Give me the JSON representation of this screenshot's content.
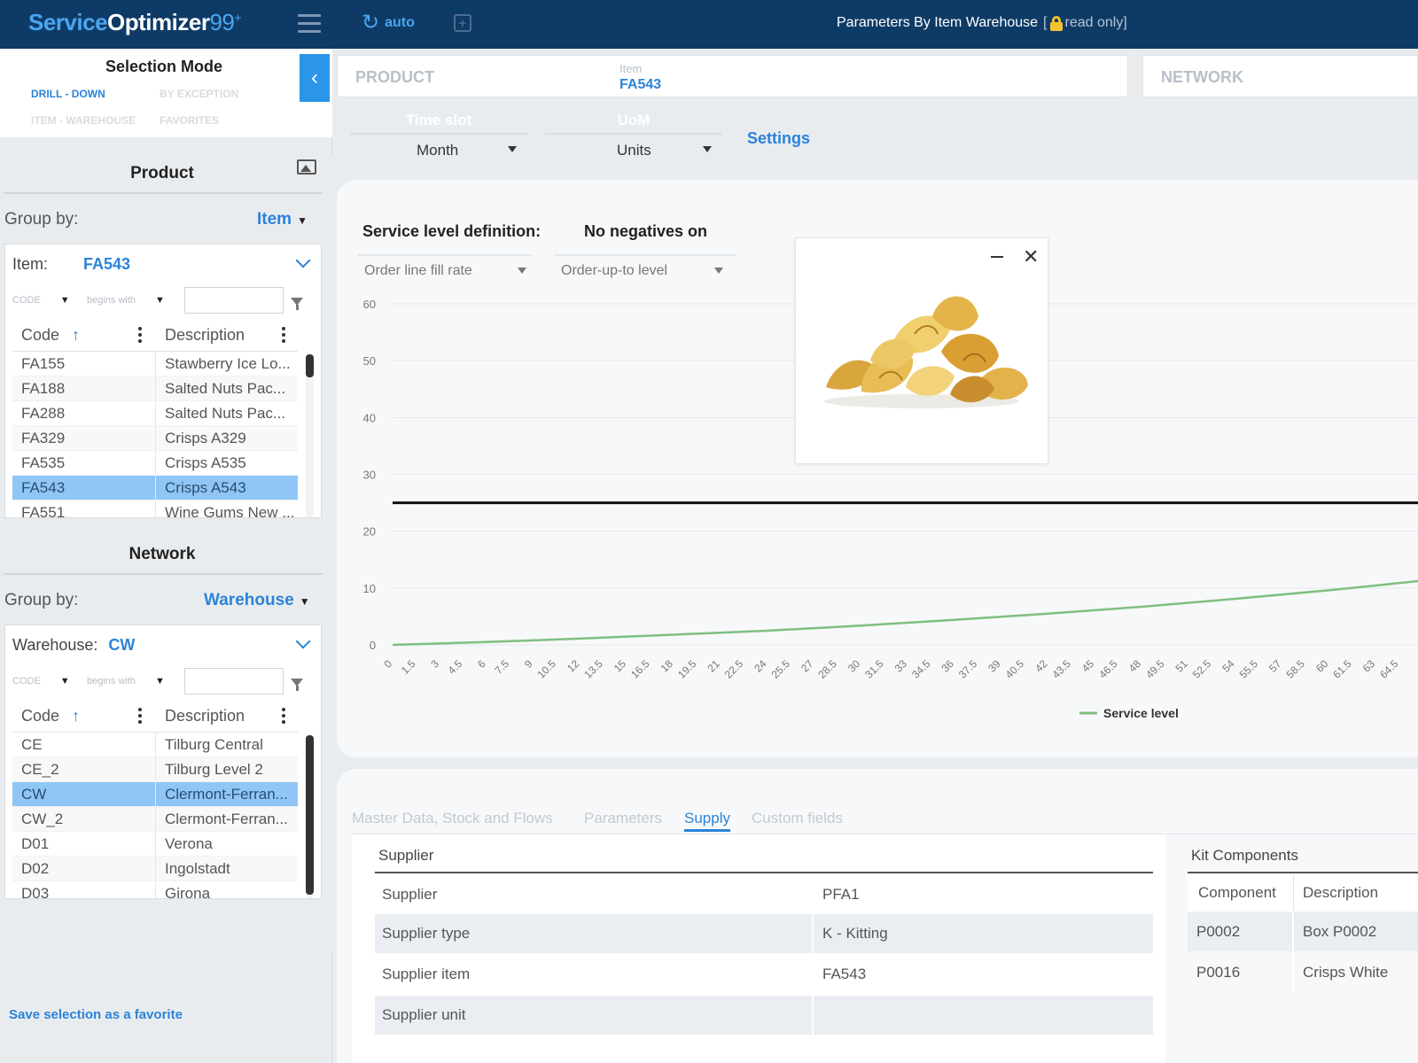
{
  "header": {
    "brand_service": "Service",
    "brand_optimizer": "Optimizer",
    "brand_version": "99",
    "brand_plus": "+",
    "refresh_label": "auto",
    "page_title": "Parameters By Item Warehouse",
    "readonly_label": "read only]",
    "readonly_open": "["
  },
  "selection_mode": {
    "title": "Selection Mode",
    "options": [
      "DRILL - DOWN",
      "BY EXCEPTION",
      "ITEM - WAREHOUSE",
      "FAVORITES"
    ]
  },
  "product": {
    "title": "Product",
    "group_by_label": "Group by:",
    "group_by_value": "Item",
    "selector_label": "Item:",
    "selector_value": "FA543",
    "filter_field": "CODE",
    "filter_op": "begins with",
    "filter_value": "",
    "columns": [
      "Code",
      "Description"
    ],
    "rows": [
      {
        "code": "FA155",
        "desc": "Stawberry Ice Lo..."
      },
      {
        "code": "FA188",
        "desc": "Salted Nuts Pac..."
      },
      {
        "code": "FA288",
        "desc": "Salted Nuts Pac..."
      },
      {
        "code": "FA329",
        "desc": "Crisps A329"
      },
      {
        "code": "FA535",
        "desc": "Crisps A535"
      },
      {
        "code": "FA543",
        "desc": "Crisps A543"
      },
      {
        "code": "FA551",
        "desc": "Wine Gums New ..."
      }
    ],
    "selected_code": "FA543"
  },
  "network": {
    "title": "Network",
    "group_by_label": "Group by:",
    "group_by_value": "Warehouse",
    "selector_label": "Warehouse:",
    "selector_value": "CW",
    "filter_field": "CODE",
    "filter_op": "begins with",
    "filter_value": "",
    "columns": [
      "Code",
      "Description"
    ],
    "rows": [
      {
        "code": "CE",
        "desc": "Tilburg Central"
      },
      {
        "code": "CE_2",
        "desc": "Tilburg Level 2"
      },
      {
        "code": "CW",
        "desc": "Clermont-Ferran..."
      },
      {
        "code": "CW_2",
        "desc": "Clermont-Ferran..."
      },
      {
        "code": "D01",
        "desc": "Verona"
      },
      {
        "code": "D02",
        "desc": "Ingolstadt"
      },
      {
        "code": "D03",
        "desc": "Girona"
      }
    ],
    "selected_code": "CW"
  },
  "save_favorite": "Save selection as a favorite",
  "main": {
    "product_placeholder": "PRODUCT",
    "item_label": "Item",
    "item_value": "FA543",
    "network_placeholder": "NETWORK",
    "time_slot_label": "Time slot",
    "time_slot_value": "Month",
    "uom_label": "UoM",
    "uom_value": "Units",
    "settings_label": "Settings"
  },
  "chart_controls": {
    "service_def_label": "Service level definition:",
    "service_def_value": "Order line fill rate",
    "no_neg_label": "No negatives on",
    "no_neg_value": "Order-up-to level"
  },
  "popup": {
    "image_subject": "potato-crisps-image"
  },
  "chart_data": {
    "type": "line",
    "title": "",
    "xlabel": "",
    "ylabel": "",
    "ylim": [
      0,
      60
    ],
    "yticks": [
      0,
      10,
      20,
      30,
      40,
      50,
      60
    ],
    "x_tick_step": 1.5,
    "x_tick_max": 66,
    "xlim_visible": [
      0,
      66
    ],
    "series": [
      {
        "name": "Service level",
        "color": "#7ec07e",
        "x": [
          0,
          6,
          12,
          18,
          24,
          30,
          36,
          42,
          48,
          54,
          60,
          66
        ],
        "y": [
          0,
          0.5,
          1.1,
          1.8,
          2.5,
          3.4,
          4.4,
          5.5,
          6.7,
          8.1,
          9.6,
          11.3
        ]
      }
    ],
    "reference_line": {
      "y": 25,
      "color": "#111111"
    },
    "grid": true,
    "legend": "bottom"
  },
  "tabs": {
    "items": [
      "Master Data, Stock and Flows",
      "Parameters",
      "Supply",
      "Custom fields"
    ],
    "active": "Supply"
  },
  "supply": {
    "header": "Supplier",
    "rows": [
      {
        "k": "Supplier",
        "v": "PFA1"
      },
      {
        "k": "Supplier type",
        "v": "K - Kitting"
      },
      {
        "k": "Supplier item",
        "v": "FA543"
      },
      {
        "k": "Supplier unit",
        "v": ""
      }
    ]
  },
  "kit": {
    "header": "Kit Components",
    "columns": [
      "Component",
      "Description"
    ],
    "rows": [
      {
        "a": "P0002",
        "b": "Box P0002"
      },
      {
        "a": "P0016",
        "b": "Crisps White"
      }
    ]
  },
  "colors": {
    "topbar": "#0e3b66",
    "accent": "#2b83d9",
    "selected_row": "#8fc6f5",
    "series": "#7ec07e"
  }
}
